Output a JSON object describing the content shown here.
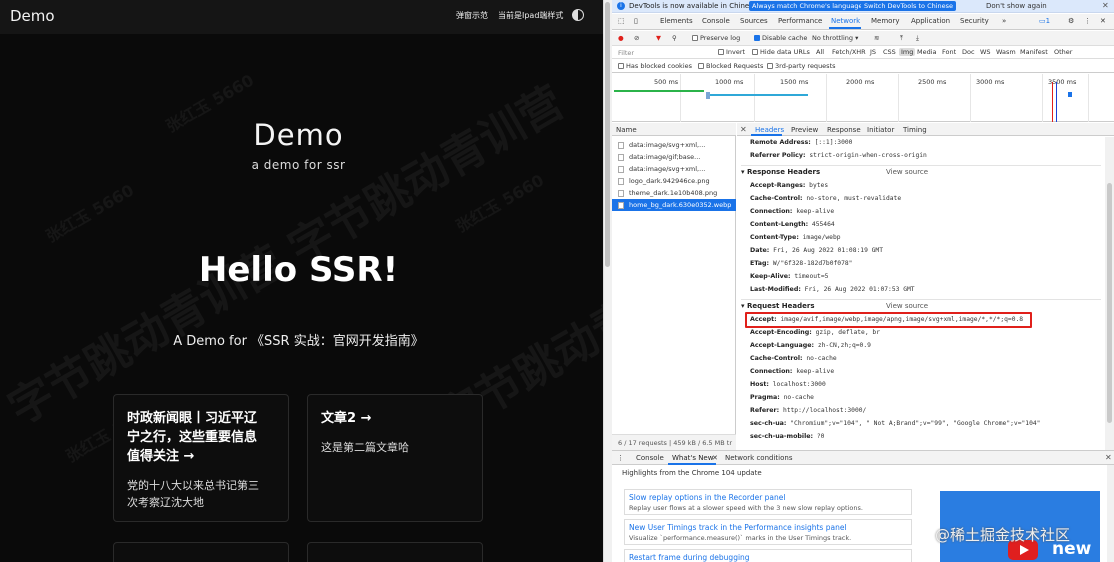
{
  "site": {
    "logo": "Demo",
    "nav": {
      "popup": "弹窗示范",
      "ipad": "当前是Ipad端样式"
    },
    "hero_title": "Demo",
    "hero_sub": "a demo for ssr",
    "hello": "Hello SSR!",
    "tagline": "A Demo for 《SSR 实战：官网开发指南》",
    "cards": [
      {
        "title_lines": [
          "时政新闻眼丨习近平辽",
          "宁之行，这些重要信息",
          "值得关注 →"
        ],
        "desc_lines": [
          "党的十八大以来总书记第三",
          "次考察辽沈大地"
        ]
      },
      {
        "title_lines": [
          "文章2 →"
        ],
        "desc_lines": [
          "这是第二篇文章哈"
        ]
      }
    ],
    "watermark": [
      "字节跳动青训营",
      "张红玉 5660"
    ]
  },
  "devtools": {
    "notice": {
      "text": "DevTools is now available in Chinese!",
      "match_btn": "Always match Chrome's language",
      "switch_btn": "Switch DevTools to Chinese",
      "dont_show": "Don't show again"
    },
    "panel_tabs": [
      "Elements",
      "Console",
      "Sources",
      "Performance",
      "Network",
      "Memory",
      "Application",
      "Security",
      "»"
    ],
    "issues_count": "1",
    "toolbar": {
      "preserve_log": "Preserve log",
      "disable_cache": "Disable cache",
      "throttling": "No throttling"
    },
    "filter": {
      "placeholder": "Filter",
      "invert": "Invert",
      "hide_data_urls": "Hide data URLs",
      "types": [
        "All",
        "Fetch/XHR",
        "JS",
        "CSS",
        "Img",
        "Media",
        "Font",
        "Doc",
        "WS",
        "Wasm",
        "Manifest",
        "Other"
      ],
      "active_type": "Img"
    },
    "blocked": {
      "has_blocked_cookies": "Has blocked cookies",
      "blocked_requests": "Blocked Requests",
      "third_party": "3rd-party requests"
    },
    "timeline_ticks": [
      "500 ms",
      "1000 ms",
      "1500 ms",
      "2000 ms",
      "2500 ms",
      "3000 ms",
      "3500 ms"
    ],
    "request_list": {
      "header": "Name",
      "items": [
        "data:image/svg+xml,...",
        "data:image/gif;base...",
        "data:image/svg+xml,...",
        "logo_dark.942946ce.png",
        "theme_dark.1e10b408.png",
        "home_bg_dark.630e0352.webp"
      ],
      "selected_index": 5,
      "status": "6 / 17 requests  |  459 kB / 6.5 MB tr"
    },
    "detail_tabs": [
      "Headers",
      "Preview",
      "Response",
      "Initiator",
      "Timing"
    ],
    "general": [
      {
        "k": "Remote Address:",
        "v": "[::1]:3000"
      },
      {
        "k": "Referrer Policy:",
        "v": "strict-origin-when-cross-origin"
      }
    ],
    "response_headers_title": "Response Headers",
    "request_headers_title": "Request Headers",
    "view_source": "View source",
    "response_headers": [
      {
        "k": "Accept-Ranges:",
        "v": "bytes"
      },
      {
        "k": "Cache-Control:",
        "v": "no-store, must-revalidate"
      },
      {
        "k": "Connection:",
        "v": "keep-alive"
      },
      {
        "k": "Content-Length:",
        "v": "455464"
      },
      {
        "k": "Content-Type:",
        "v": "image/webp"
      },
      {
        "k": "Date:",
        "v": "Fri, 26 Aug 2022 01:08:19 GMT"
      },
      {
        "k": "ETag:",
        "v": "W/\"6f328-182d7b0f078\""
      },
      {
        "k": "Keep-Alive:",
        "v": "timeout=5"
      },
      {
        "k": "Last-Modified:",
        "v": "Fri, 26 Aug 2022 01:07:53 GMT"
      }
    ],
    "request_headers": [
      {
        "k": "Accept:",
        "v": "image/avif,image/webp,image/apng,image/svg+xml,image/*,*/*;q=0.8"
      },
      {
        "k": "Accept-Encoding:",
        "v": "gzip, deflate, br"
      },
      {
        "k": "Accept-Language:",
        "v": "zh-CN,zh;q=0.9"
      },
      {
        "k": "Cache-Control:",
        "v": "no-cache"
      },
      {
        "k": "Connection:",
        "v": "keep-alive"
      },
      {
        "k": "Host:",
        "v": "localhost:3000"
      },
      {
        "k": "Pragma:",
        "v": "no-cache"
      },
      {
        "k": "Referer:",
        "v": "http://localhost:3000/"
      },
      {
        "k": "sec-ch-ua:",
        "v": "\"Chromium\";v=\"104\", \" Not A;Brand\";v=\"99\", \"Google Chrome\";v=\"104\""
      },
      {
        "k": "sec-ch-ua-mobile:",
        "v": "?0"
      }
    ],
    "drawer": {
      "tabs": [
        "Console",
        "What's New",
        "Network conditions"
      ],
      "highlights": "Highlights from the Chrome 104 update",
      "items": [
        {
          "title": "Slow replay options in the Recorder panel",
          "desc": "Replay user flows at a slower speed with the 3 new slow replay options."
        },
        {
          "title": "New User Timings track in the Performance insights panel",
          "desc": "Visualize `performance.measure()` marks in the User Timings track."
        },
        {
          "title": "Restart frame during debugging",
          "desc": ""
        }
      ],
      "video_label": "new"
    },
    "corner_watermark": "@稀土掘金技术社区"
  },
  "colors": {
    "accent": "#1a73e8",
    "highlight_box": "#e0201b",
    "page_bg": "#0a0a0a"
  }
}
